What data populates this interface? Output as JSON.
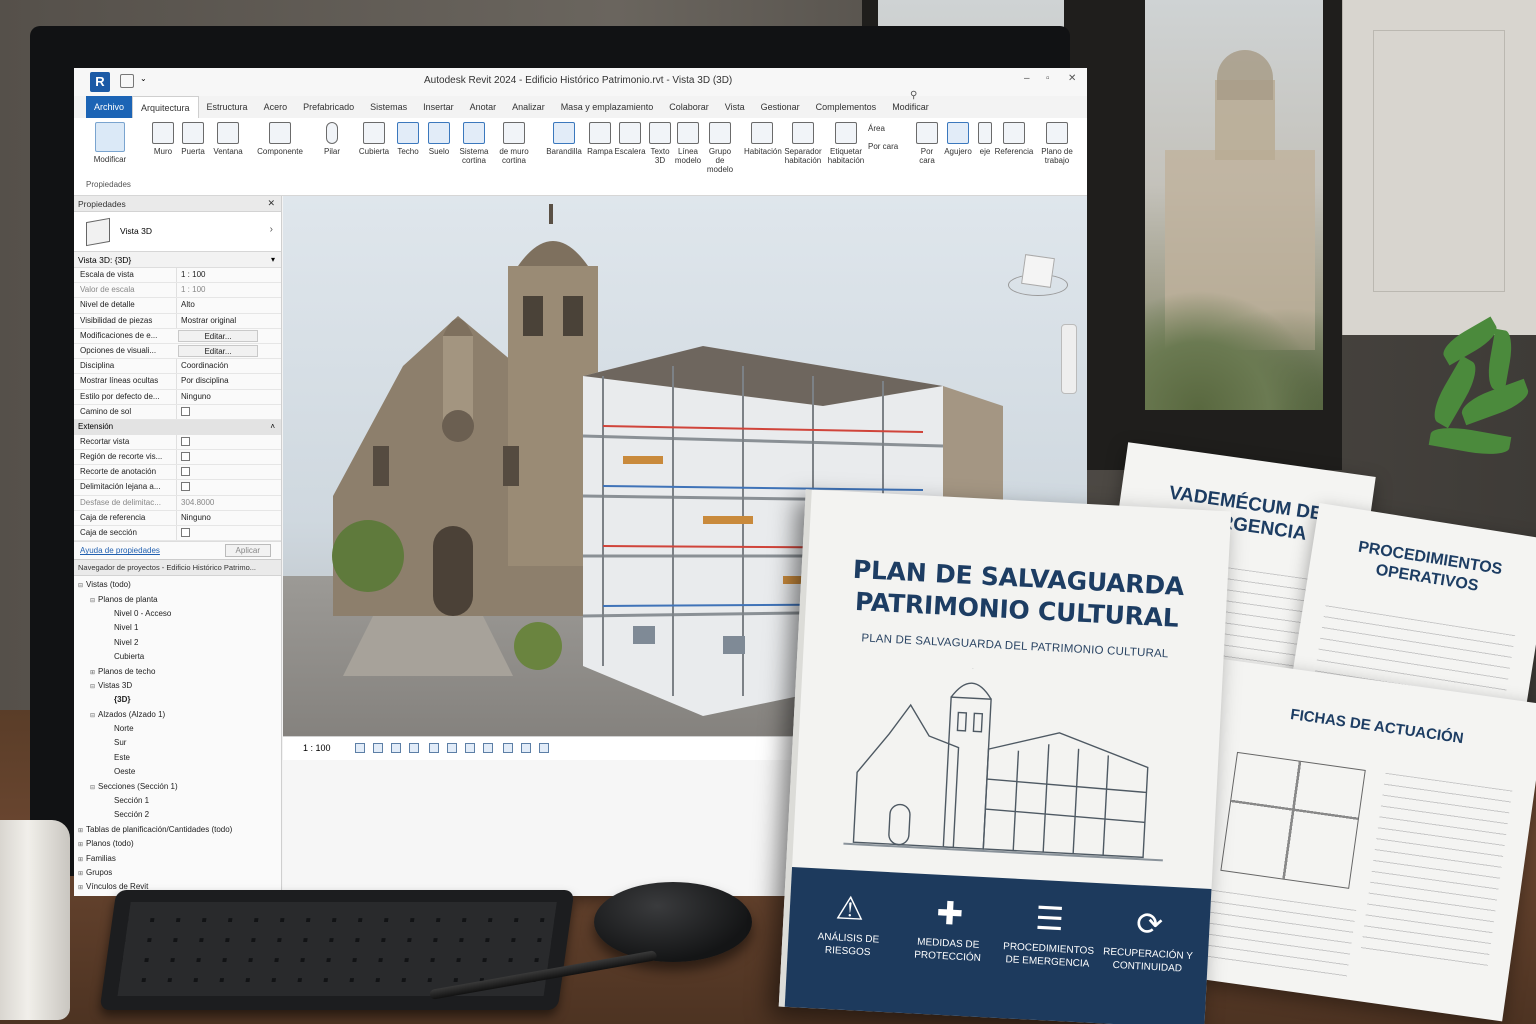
{
  "app": {
    "logo": "R",
    "window_title": "Autodesk Revit 2024 - Edificio Histórico Patrimonio.rvt - Vista 3D (3D)"
  },
  "ribbon": {
    "tabs": [
      "Archivo",
      "Arquitectura",
      "Estructura",
      "Acero",
      "Prefabricado",
      "Sistemas",
      "Insertar",
      "Anotar",
      "Analizar",
      "Masa y emplazamiento",
      "Colaborar",
      "Vista",
      "Gestionar",
      "Complementos",
      "Modificar"
    ],
    "active_tab": "Arquitectura",
    "buttons": {
      "modificar": "Modificar",
      "muro": "Muro",
      "puerta": "Puerta",
      "ventana": "Ventana",
      "componente": "Componente",
      "pilar": "Pilar",
      "cubierta": "Cubierta",
      "techo": "Techo",
      "suelo": "Suelo",
      "sistema_cortina": "Sistema cortina",
      "muro_cortina": "de muro cortina",
      "barandilla": "Barandilla",
      "rampa": "Rampa",
      "escalera": "Escalera",
      "texto3d": "Texto 3D",
      "linea_modelo": "Línea modelo",
      "grupo_modelo": "Grupo de modelo",
      "habitacion": "Habitación",
      "separador": "Separador habitación",
      "etiquetar": "Etiquetar habitación",
      "area": "Área",
      "por_cara": "Por cara",
      "por_cara_2": "Por cara",
      "agujero": "Agujero",
      "eje": "eje",
      "referencia": "Referencia",
      "plano_trabajo": "Plano de trabajo"
    },
    "panel_label": "Propiedades"
  },
  "properties": {
    "header": "Propiedades",
    "type": "Vista 3D",
    "instance": "Vista 3D: {3D}",
    "rows": [
      {
        "k": "Escala de vista",
        "v": "1 : 100"
      },
      {
        "k": "Valor de escala",
        "v": "1 : 100"
      },
      {
        "k": "Nivel de detalle",
        "v": "Alto"
      },
      {
        "k": "Visibilidad de piezas",
        "v": "Mostrar original"
      },
      {
        "k": "Modificaciones de e...",
        "v": "Editar..."
      },
      {
        "k": "Opciones de visuali...",
        "v": "Editar..."
      },
      {
        "k": "Disciplina",
        "v": "Coordinación"
      },
      {
        "k": "Mostrar líneas ocultas",
        "v": "Por disciplina"
      },
      {
        "k": "Estilo por defecto de...",
        "v": "Ninguno"
      },
      {
        "k": "Camino de sol",
        "v": ""
      }
    ],
    "group_extension": "Extensión",
    "extension_rows": [
      {
        "k": "Recortar vista",
        "v": ""
      },
      {
        "k": "Región de recorte vis...",
        "v": ""
      },
      {
        "k": "Recorte de anotación",
        "v": ""
      },
      {
        "k": "Delimitación lejana a...",
        "v": ""
      },
      {
        "k": "Desfase de delimitac...",
        "v": "304.8000"
      },
      {
        "k": "Caja de referencia",
        "v": "Ninguno"
      },
      {
        "k": "Caja de sección",
        "v": ""
      }
    ],
    "help_link": "Ayuda de propiedades",
    "apply": "Aplicar"
  },
  "browser": {
    "header": "Navegador de proyectos - Edificio Histórico Patrimo...",
    "items": [
      {
        "label": "Vistas (todo)",
        "level": 0,
        "toggle": "⊟"
      },
      {
        "label": "Planos de planta",
        "level": 1,
        "toggle": "⊟"
      },
      {
        "label": "Nivel 0 - Acceso",
        "level": 3,
        "toggle": ""
      },
      {
        "label": "Nivel 1",
        "level": 3,
        "toggle": ""
      },
      {
        "label": "Nivel 2",
        "level": 3,
        "toggle": ""
      },
      {
        "label": "Cubierta",
        "level": 3,
        "toggle": ""
      },
      {
        "label": "Planos de techo",
        "level": 1,
        "toggle": "⊞"
      },
      {
        "label": "Vistas 3D",
        "level": 1,
        "toggle": "⊟"
      },
      {
        "label": "{3D}",
        "level": 3,
        "toggle": ""
      },
      {
        "label": "Alzados (Alzado 1)",
        "level": 1,
        "toggle": "⊟"
      },
      {
        "label": "Norte",
        "level": 3,
        "toggle": ""
      },
      {
        "label": "Sur",
        "level": 3,
        "toggle": ""
      },
      {
        "label": "Este",
        "level": 3,
        "toggle": ""
      },
      {
        "label": "Oeste",
        "level": 3,
        "toggle": ""
      },
      {
        "label": "Secciones (Sección 1)",
        "level": 1,
        "toggle": "⊟"
      },
      {
        "label": "Sección 1",
        "level": 3,
        "toggle": ""
      },
      {
        "label": "Sección 2",
        "level": 3,
        "toggle": ""
      },
      {
        "label": "Tablas de planificación/Cantidades (todo)",
        "level": 0,
        "toggle": "⊞"
      },
      {
        "label": "Planos (todo)",
        "level": 0,
        "toggle": "⊞"
      },
      {
        "label": "Familias",
        "level": 0,
        "toggle": "⊞"
      },
      {
        "label": "Grupos",
        "level": 0,
        "toggle": "⊞"
      },
      {
        "label": "Vínculos de Revit",
        "level": 0,
        "toggle": "⊞"
      }
    ]
  },
  "viewport": {
    "scale": "1 : 100"
  },
  "book": {
    "title": "PLAN DE SALVAGUARDA PATRIMONIO CULTURAL",
    "subtitle": "PLAN DE SALVAGUARDA DEL PATRIMONIO CULTURAL",
    "sections": [
      {
        "label": "ANÁLISIS DE RIESGOS",
        "icon": "warning-icon",
        "glyph": "⚠"
      },
      {
        "label": "MEDIDAS DE PROTECCIÓN",
        "icon": "shield-icon",
        "glyph": "✚"
      },
      {
        "label": "PROCEDIMIENTOS DE EMERGENCIA",
        "icon": "clipboard-icon",
        "glyph": "☰"
      },
      {
        "label": "RECUPERACIÓN Y CONTINUIDAD",
        "icon": "recovery-icon",
        "glyph": "⟳"
      }
    ]
  },
  "documents": {
    "vademecum": "VADEMÉCUM DE EMERGENCIA",
    "procedimientos": "PROCEDIMIENTOS OPERATIVOS",
    "fichas": "FICHAS DE ACTUACIÓN"
  },
  "colors": {
    "revit_blue": "#1c64b5",
    "book_navy": "#1d3a5d",
    "title_navy": "#1d3d63"
  }
}
